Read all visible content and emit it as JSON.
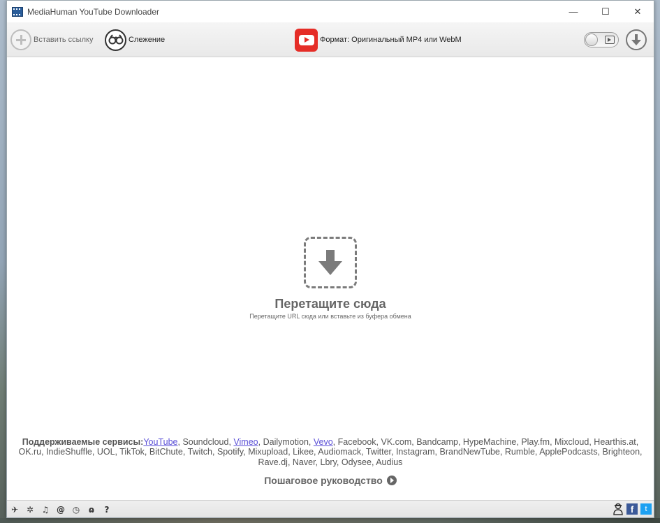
{
  "window": {
    "title": "MediaHuman YouTube Downloader"
  },
  "window_controls": {
    "minimize": "—",
    "maximize": "☐",
    "close": "✕"
  },
  "toolbar": {
    "paste_label": "Вставить ссылку",
    "tracking_label": "Слежение",
    "format_label": "Формат: Оригинальный MP4 или WebM"
  },
  "drop": {
    "title": "Перетащите сюда",
    "subtitle": "Перетащите URL сюда или вставьте из буфера обмена"
  },
  "services": {
    "label": "Поддерживаемые сервисы:",
    "items": [
      {
        "name": "YouTube",
        "link": true
      },
      {
        "name": "Soundcloud",
        "link": false
      },
      {
        "name": "Vimeo",
        "link": true
      },
      {
        "name": "Dailymotion",
        "link": false
      },
      {
        "name": "Vevo",
        "link": true
      },
      {
        "name": "Facebook",
        "link": false
      },
      {
        "name": "VK.com",
        "link": false
      },
      {
        "name": "Bandcamp",
        "link": false
      },
      {
        "name": "HypeMachine",
        "link": false
      },
      {
        "name": "Play.fm",
        "link": false
      },
      {
        "name": "Mixcloud",
        "link": false
      },
      {
        "name": "Hearthis.at",
        "link": false
      },
      {
        "name": "OK.ru",
        "link": false
      },
      {
        "name": "IndieShuffle",
        "link": false
      },
      {
        "name": "UOL",
        "link": false
      },
      {
        "name": "TikTok",
        "link": false
      },
      {
        "name": "BitChute",
        "link": false
      },
      {
        "name": "Twitch",
        "link": false
      },
      {
        "name": "Spotify",
        "link": false
      },
      {
        "name": "Mixupload",
        "link": false
      },
      {
        "name": "Likee",
        "link": false
      },
      {
        "name": "Audiomack",
        "link": false
      },
      {
        "name": "Twitter",
        "link": false
      },
      {
        "name": "Instagram",
        "link": false
      },
      {
        "name": "BrandNewTube",
        "link": false
      },
      {
        "name": "Rumble",
        "link": false
      },
      {
        "name": "ApplePodcasts",
        "link": false
      },
      {
        "name": "Brighteon",
        "link": false
      },
      {
        "name": "Rave.dj",
        "link": false
      },
      {
        "name": "Naver",
        "link": false
      },
      {
        "name": "Lbry",
        "link": false
      },
      {
        "name": "Odysee",
        "link": false
      },
      {
        "name": "Audius",
        "link": false
      }
    ]
  },
  "guide": {
    "label": "Пошаговое руководство"
  },
  "statusbar": {
    "left_icons": [
      {
        "name": "send-icon",
        "glyph": "✈"
      },
      {
        "name": "settings-icon",
        "glyph": "✲"
      },
      {
        "name": "music-icon",
        "glyph": "♫"
      },
      {
        "name": "snail-icon",
        "glyph": "@"
      },
      {
        "name": "clock-icon",
        "glyph": "◷"
      },
      {
        "name": "binoculars-icon",
        "glyph": "ɷ"
      },
      {
        "name": "help-icon",
        "glyph": "?"
      }
    ],
    "facebook": "f",
    "twitter": "t"
  },
  "colors": {
    "youtube_red": "#e52d27",
    "link": "#5a4fd6",
    "facebook": "#3b5998",
    "twitter": "#1da1f2"
  }
}
